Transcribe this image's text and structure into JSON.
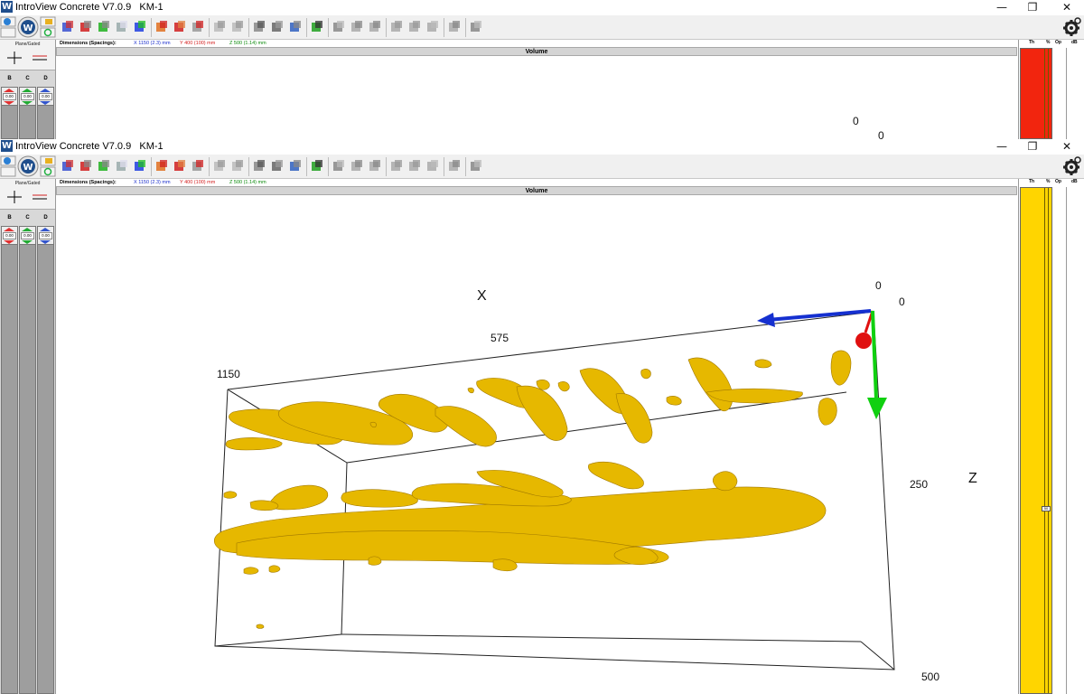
{
  "app": {
    "icon_letter": "W",
    "title": "IntroView Concrete V7.0.9   KM-1"
  },
  "window_buttons": {
    "minimize": "—",
    "restore": "❐",
    "close": "✕"
  },
  "dimensions": {
    "label": "Dimensions (Spacings):",
    "x": "X   1150 (2.3) mm",
    "y": "Y   400 (100) mm",
    "z": "Z   500 (1.14) mm",
    "x_color": "#1a2dcc",
    "y_color": "#d42020",
    "z_color": "#0a8a0a"
  },
  "view_title": "Volume",
  "left_panel": {
    "mode_label": "Plane/Gated",
    "columns": [
      {
        "letter": "B",
        "value": "0.00",
        "color": "#e03030"
      },
      {
        "letter": "C",
        "value": "0.00",
        "color": "#22aa33"
      },
      {
        "letter": "D",
        "value": "0.00",
        "color": "#3355cc"
      }
    ]
  },
  "right_panel": {
    "headers": [
      "Th",
      "%",
      "Op",
      "dB"
    ],
    "top_bar_color": "#f2250e",
    "bottom_bar_color": "#ffd500",
    "slider_label": "50"
  },
  "top_window_axes": {
    "a": "0",
    "b": "0"
  },
  "axes": {
    "x_label": "X",
    "z_label": "Z",
    "x_mid": "575",
    "x_end": "1150",
    "zero_a": "0",
    "zero_b": "0",
    "z_mid": "250",
    "z_end": "500"
  },
  "colors": {
    "rebar": "#e6b800",
    "axis_x": "#1530d0",
    "axis_y": "#e01010",
    "axis_z": "#10d010"
  }
}
